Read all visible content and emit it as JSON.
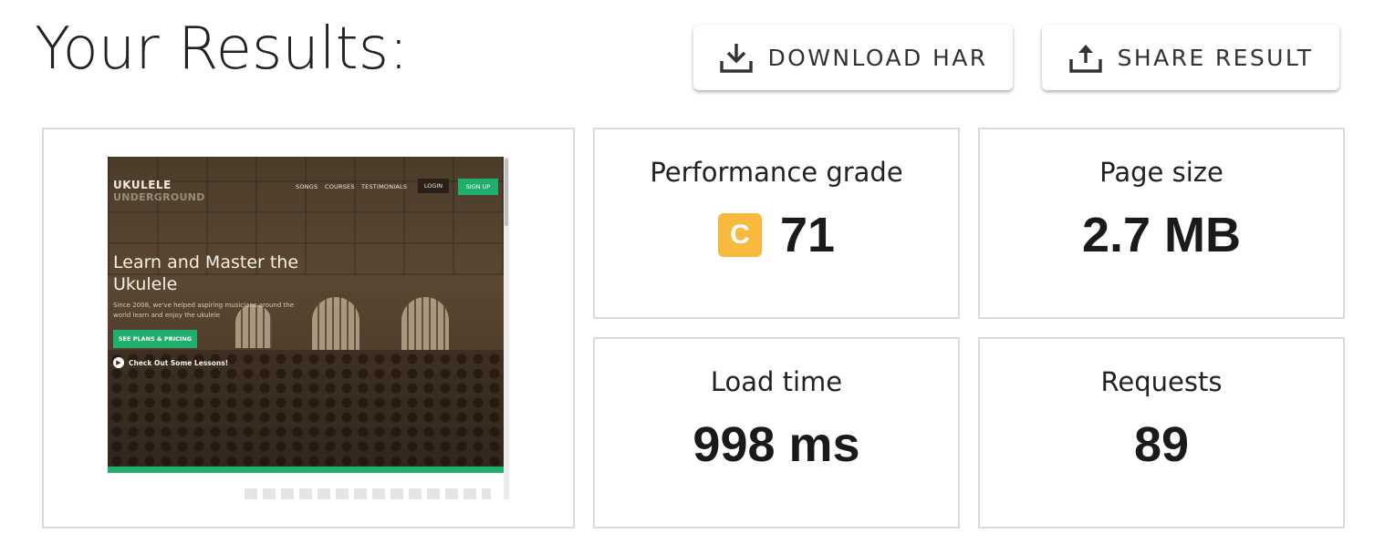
{
  "title": "Your Results:",
  "buttons": {
    "download": "DOWNLOAD HAR",
    "share": "SHARE RESULT"
  },
  "screenshot": {
    "logo": "UKULELE",
    "logo_sub": "UNDERGROUND",
    "nav": [
      "SONGS",
      "COURSES",
      "TESTIMONIALS"
    ],
    "login": "LOGIN",
    "signup": "SIGN UP",
    "headline": "Learn and Master the Ukulele",
    "subtext": "Since 2008, we've helped aspiring musicians around the world learn and enjoy the ukulele",
    "cta": "SEE PLANS & PRICING",
    "lessons_link": "Check Out Some Lessons!",
    "accent_color": "#1fae6e"
  },
  "metrics": {
    "performance": {
      "label": "Performance grade",
      "grade": "C",
      "grade_color": "#f7b93e",
      "value": "71"
    },
    "page_size": {
      "label": "Page size",
      "value": "2.7 MB"
    },
    "load_time": {
      "label": "Load time",
      "value": "998 ms"
    },
    "requests": {
      "label": "Requests",
      "value": "89"
    }
  },
  "icons": {
    "download": "download-icon",
    "share": "share-icon"
  }
}
